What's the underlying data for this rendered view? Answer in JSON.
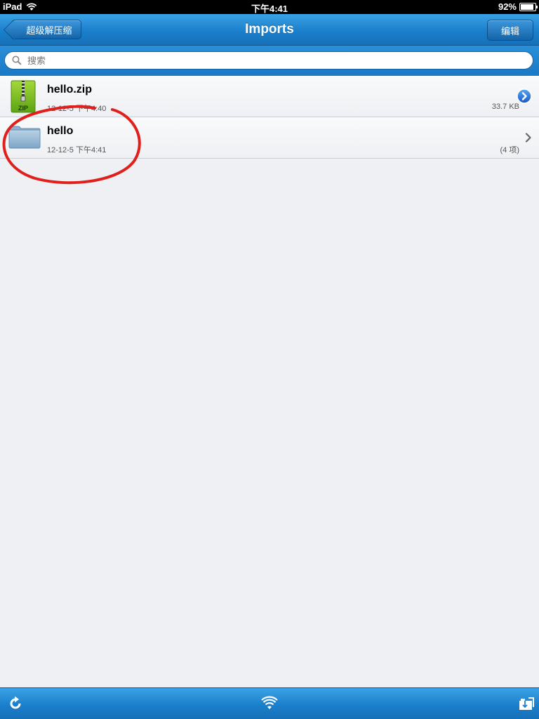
{
  "status_bar": {
    "device": "iPad",
    "time": "下午4:41",
    "battery": "92%",
    "battery_level": 0.92
  },
  "nav": {
    "back_label": "超级解压缩",
    "title": "Imports",
    "edit_label": "编辑"
  },
  "search": {
    "placeholder": "搜索"
  },
  "files": [
    {
      "name": "hello.zip",
      "date": "12-12-5 下午4:40",
      "meta": "33.7 KB",
      "icon": "zip-file-icon",
      "accessory": "detail-disclosure-button"
    },
    {
      "name": "hello",
      "date": "12-12-5 下午4:41",
      "meta": "(4 项)",
      "icon": "folder-icon",
      "accessory": "chevron-right-icon"
    }
  ],
  "toolbar": {
    "items": [
      "refresh-icon",
      "wifi-icon",
      "folder-icon"
    ]
  },
  "colors": {
    "bar_blue": "#1b7fcb",
    "annotation_red": "#e0201c"
  }
}
